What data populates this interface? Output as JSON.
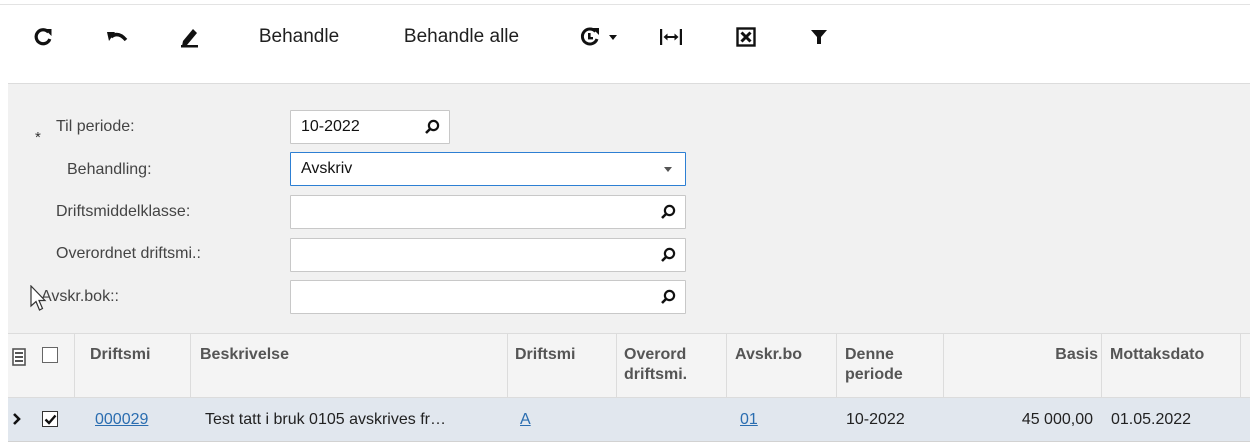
{
  "toolbar": {
    "refresh_icon": "refresh-icon",
    "undo_icon": "undo-icon",
    "edit_icon": "pencil-icon",
    "process_label": "Behandle",
    "process_all_label": "Behandle alle",
    "schedule_icon": "schedule-refresh-icon",
    "fit_icon": "fit-width-icon",
    "excel_icon": "excel-export-icon",
    "filter_icon": "filter-icon"
  },
  "form": {
    "required_mark": "*",
    "period_label": "Til periode:",
    "period_value": "10-2022",
    "processing_label": "Behandling:",
    "processing_value": "Avskriv",
    "asset_class_label": "Driftsmiddelklasse:",
    "asset_class_value": "",
    "parent_asset_label": "Overordnet driftsmi.:",
    "parent_asset_value": "",
    "book_label": "Avskr.bok::",
    "book_value": ""
  },
  "grid": {
    "columns": [
      "Driftsmi",
      "Beskrivelse",
      "Driftsmi",
      "Overord driftsmi.",
      "Avskr.bo",
      "Denne periode",
      "Basis",
      "Mottaksdato"
    ],
    "rows": [
      {
        "selected": true,
        "asset_id": "000029",
        "description": "Test tatt i bruk 0105 avskrives fr…",
        "asset_class": "A",
        "parent": "",
        "book": "01",
        "period": "10-2022",
        "basis": "45 000,00",
        "received": "01.05.2022"
      }
    ]
  },
  "colors": {
    "accent": "#2d7fd3",
    "link": "#2a6db0",
    "selected_row": "#e1e7ee",
    "panel": "#f1f1f1"
  }
}
